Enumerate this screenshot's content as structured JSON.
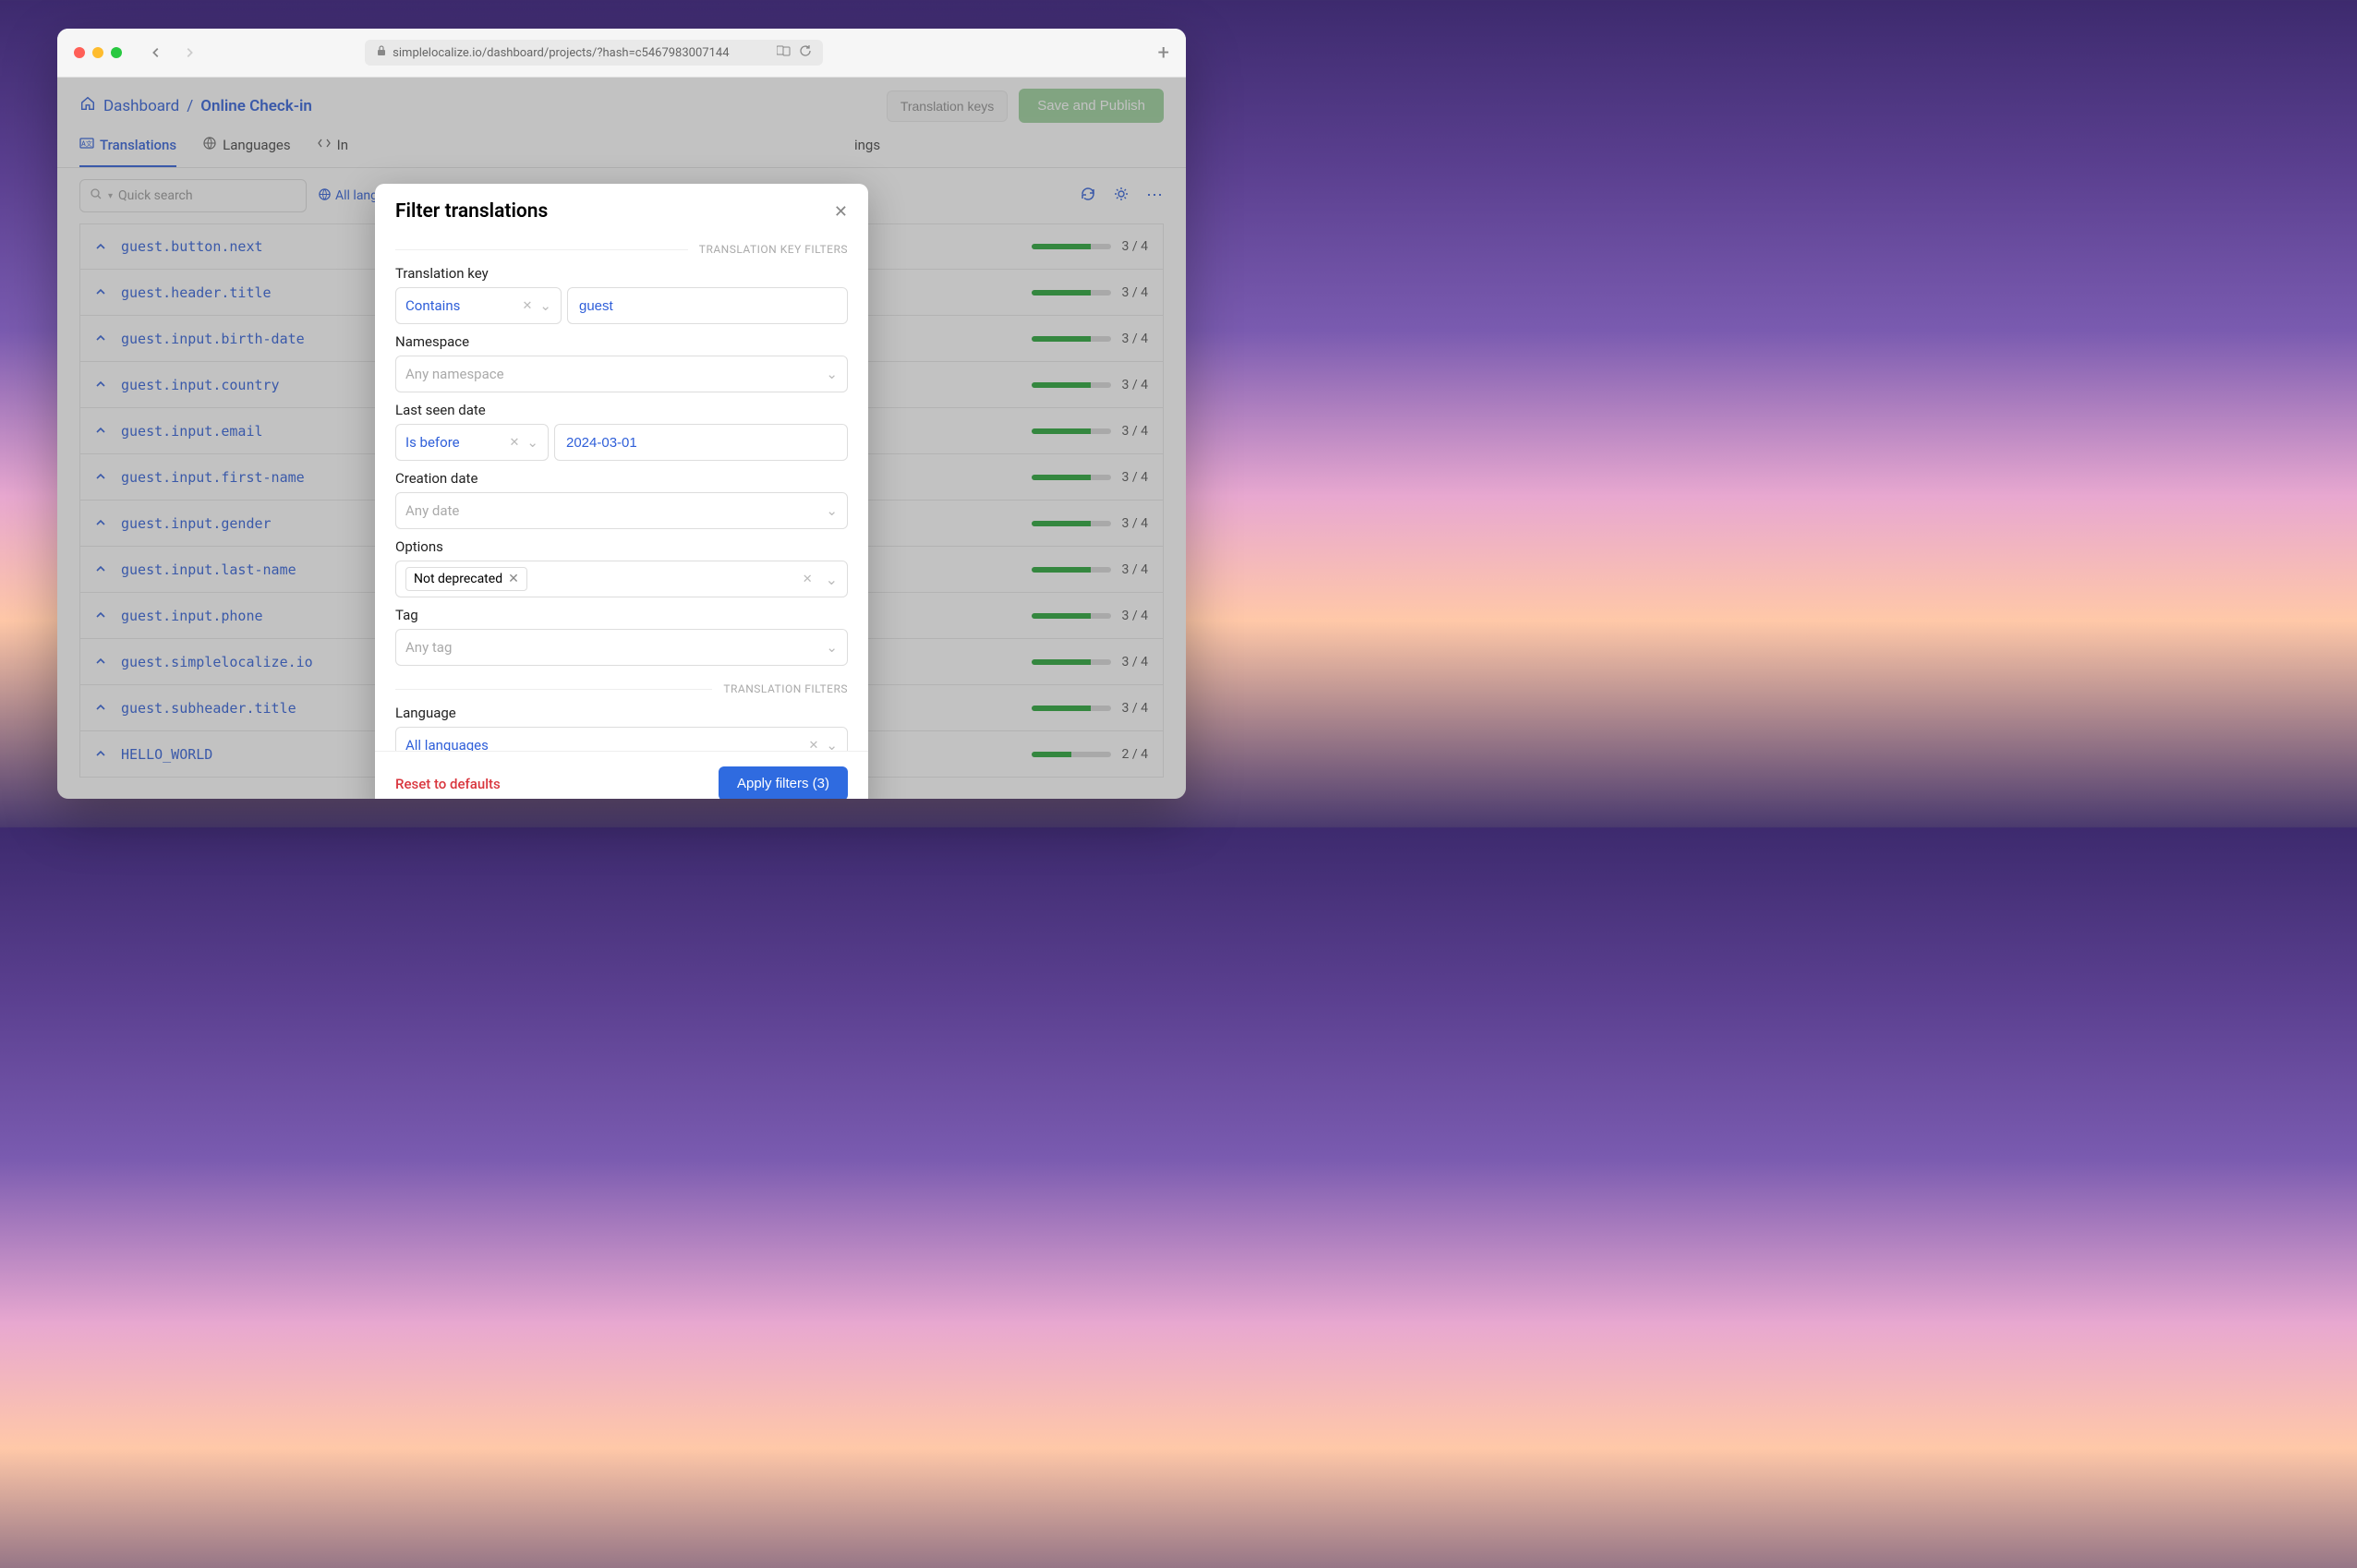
{
  "browser": {
    "url": "simplelocalize.io/dashboard/projects/?hash=c5467983007144"
  },
  "header": {
    "home_link": "Dashboard",
    "sep": "/",
    "current": "Online Check-in",
    "translation_keys_btn": "Translation keys",
    "save_publish_btn": "Save and Publish"
  },
  "tabs": {
    "translations": "Translations",
    "languages": "Languages",
    "integrations": "In",
    "settings": "ings"
  },
  "toolbar": {
    "search_placeholder": "Quick search",
    "lang_filter": "All lang"
  },
  "keys": [
    {
      "name": "guest.button.next",
      "done": 3,
      "total": 4
    },
    {
      "name": "guest.header.title",
      "done": 3,
      "total": 4
    },
    {
      "name": "guest.input.birth-date",
      "done": 3,
      "total": 4
    },
    {
      "name": "guest.input.country",
      "done": 3,
      "total": 4
    },
    {
      "name": "guest.input.email",
      "done": 3,
      "total": 4
    },
    {
      "name": "guest.input.first-name",
      "done": 3,
      "total": 4
    },
    {
      "name": "guest.input.gender",
      "done": 3,
      "total": 4
    },
    {
      "name": "guest.input.last-name",
      "done": 3,
      "total": 4
    },
    {
      "name": "guest.input.phone",
      "done": 3,
      "total": 4
    },
    {
      "name": "guest.simplelocalize.io",
      "done": 3,
      "total": 4
    },
    {
      "name": "guest.subheader.title",
      "done": 3,
      "total": 4
    },
    {
      "name": "HELLO_WORLD",
      "done": 2,
      "total": 4
    }
  ],
  "modal": {
    "title": "Filter translations",
    "section_key_filters": "TRANSLATION KEY FILTERS",
    "section_translation_filters": "TRANSLATION FILTERS",
    "translation_key_label": "Translation key",
    "translation_key_op": "Contains",
    "translation_key_value": "guest",
    "namespace_label": "Namespace",
    "namespace_placeholder": "Any namespace",
    "last_seen_label": "Last seen date",
    "last_seen_op": "Is before",
    "last_seen_value": "2024-03-01",
    "creation_date_label": "Creation date",
    "creation_date_placeholder": "Any date",
    "options_label": "Options",
    "options_tag": "Not deprecated",
    "tag_label": "Tag",
    "tag_placeholder": "Any tag",
    "language_label": "Language",
    "language_value": "All languages",
    "reset_label": "Reset to defaults",
    "apply_label": "Apply filters (3)"
  }
}
